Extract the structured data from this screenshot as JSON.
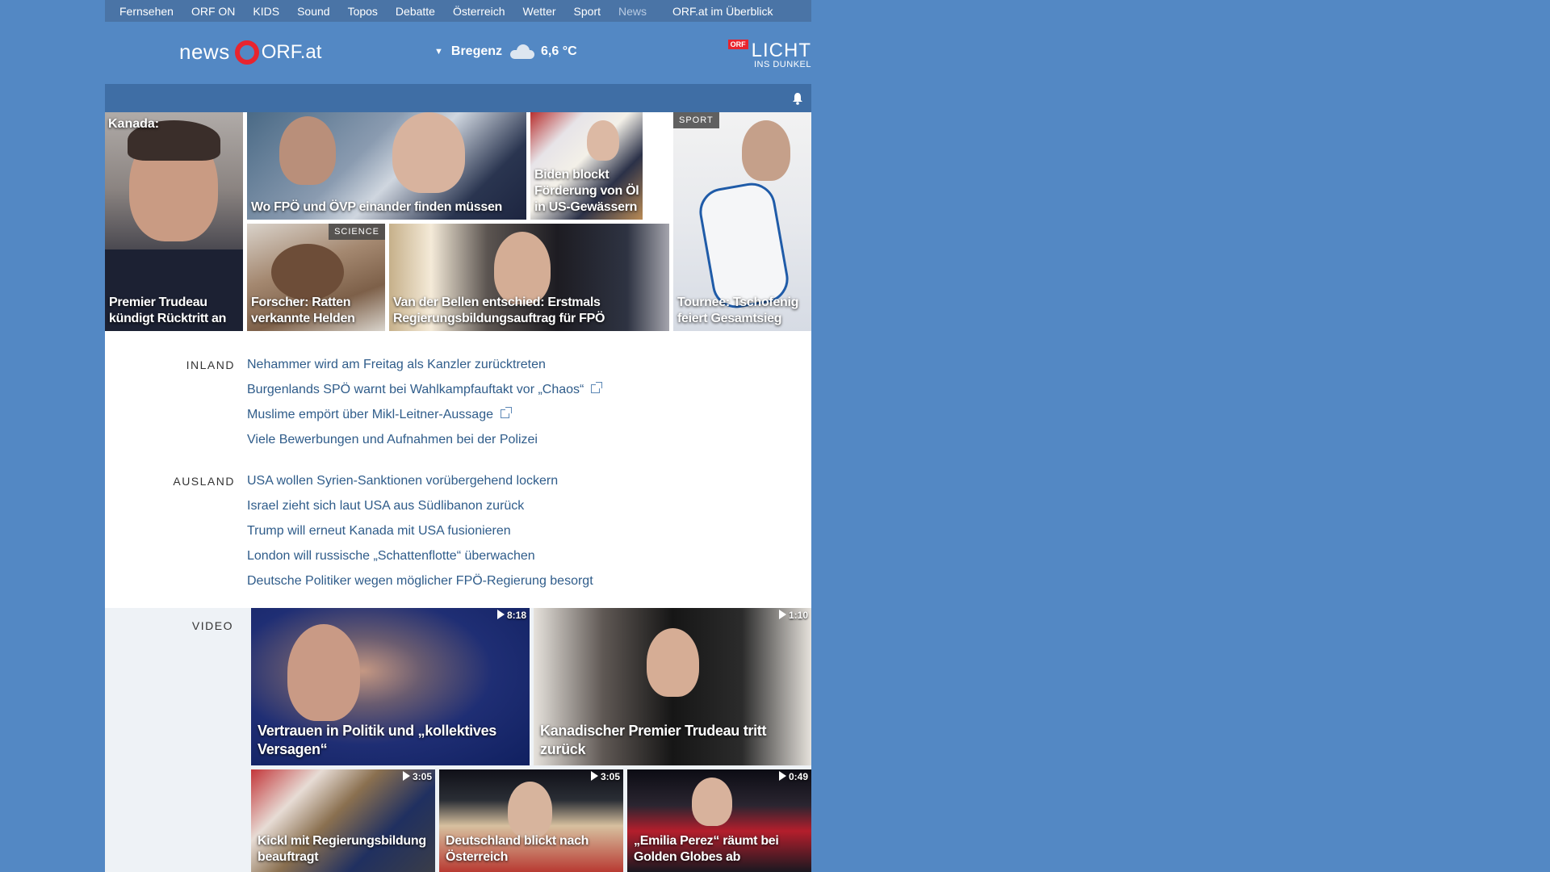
{
  "topnav": {
    "items": [
      "Fernsehen",
      "ORF ON",
      "KIDS",
      "Sound",
      "Topos",
      "Debatte",
      "Österreich",
      "Wetter",
      "Sport",
      "News"
    ],
    "active": "News",
    "overview": "ORF.at im Überblick"
  },
  "header": {
    "logo_news": "news",
    "logo_orfat": "ORF.at",
    "weather_location": "Bregenz",
    "weather_temp": "6,6 °C",
    "licht_badge": "ORF",
    "licht_title": "LICHT",
    "licht_subtitle": "INS DUNKEL"
  },
  "tiles": {
    "trudeau": {
      "top": "Kanada:",
      "caption": "Premier Trudeau kündigt Rücktritt an"
    },
    "fpo": {
      "caption": "Wo FPÖ und ÖVP einander finden müssen"
    },
    "biden": {
      "caption": "Biden blockt Förderung von Öl in US-Gewässern"
    },
    "sport": {
      "tag": "SPORT",
      "caption": "Tournee: Tschofenig feiert Gesamtsieg"
    },
    "rat": {
      "tag": "SCIENCE",
      "caption": "Forscher: Ratten verkannte Helden"
    },
    "vdb": {
      "caption": "Van der Bellen entschied: Erstmals Regierungsbildungsauftrag für FPÖ"
    }
  },
  "inland": {
    "label": "INLAND",
    "items": [
      "Nehammer wird am Freitag als Kanzler zurücktreten",
      "Burgenlands SPÖ warnt bei Wahlkampfauftakt vor „Chaos“",
      "Muslime empört über Mikl-Leitner-Aussage",
      "Viele Bewerbungen und Aufnahmen bei der Polizei"
    ]
  },
  "ausland": {
    "label": "AUSLAND",
    "items": [
      "USA wollen Syrien-Sanktionen vorübergehend lockern",
      "Israel zieht sich laut USA aus Südlibanon zurück",
      "Trump will erneut Kanada mit USA fusionieren",
      "London will russische „Schattenflotte“ überwachen",
      "Deutsche Politiker wegen möglicher FPÖ-Regierung besorgt"
    ]
  },
  "video": {
    "label": "VIDEO",
    "items": [
      {
        "duration": "8:18",
        "caption": "Vertrauen in Politik und „kollektives Versagen“"
      },
      {
        "duration": "1:10",
        "caption": "Kanadischer Premier Trudeau tritt zurück"
      },
      {
        "duration": "3:05",
        "caption": "Kickl mit Regierungsbildung beauftragt"
      },
      {
        "duration": "3:05",
        "caption": "Deutschland blickt nach Österreich"
      },
      {
        "duration": "0:49",
        "caption": "„Emilia Perez“ räumt bei Golden Globes ab"
      }
    ]
  },
  "colors": {
    "page_bg": "#5388c4",
    "nav_bg": "#4a74a6",
    "subbar_bg": "#3f6ea5",
    "link": "#2f5c8a",
    "orf_red": "#e8242e"
  },
  "icons": [
    "weather-cloud-icon",
    "bell-icon",
    "external-link-icon",
    "play-icon",
    "orf-ring-icon"
  ]
}
